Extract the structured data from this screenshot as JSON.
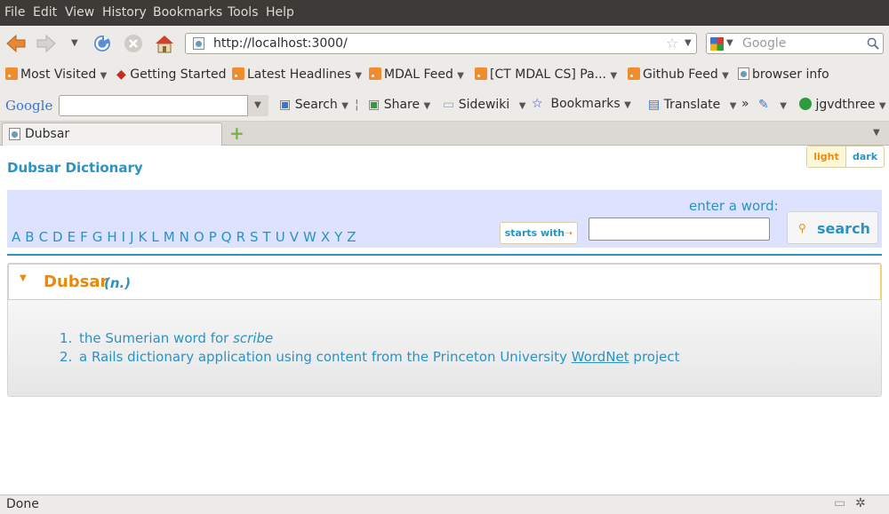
{
  "menubar": [
    "File",
    "Edit",
    "View",
    "History",
    "Bookmarks",
    "Tools",
    "Help"
  ],
  "url": "http://localhost:3000/",
  "search_engine_placeholder": "Google",
  "bookmarks": [
    "Most Visited",
    "Getting Started",
    "Latest Headlines",
    "MDAL Feed",
    "[CT MDAL CS] Pa...",
    "Github Feed",
    "browser info"
  ],
  "google_toolbar": {
    "logo": "Google",
    "search": "Search",
    "share": "Share",
    "sidewiki": "Sidewiki",
    "bookmarks": "Bookmarks",
    "translate": "Translate",
    "more": "»",
    "user": "jgvdthree"
  },
  "tab": {
    "title": "Dubsar"
  },
  "page": {
    "site_title": "Dubsar Dictionary",
    "theme_light": "light",
    "theme_dark": "dark",
    "letters": [
      "A",
      "B",
      "C",
      "D",
      "E",
      "F",
      "G",
      "H",
      "I",
      "J",
      "K",
      "L",
      "M",
      "N",
      "O",
      "P",
      "Q",
      "R",
      "S",
      "T",
      "U",
      "V",
      "W",
      "X",
      "Y",
      "Z"
    ],
    "enter_word": "enter a word:",
    "starts_with": "starts with",
    "starts_with_arrow": "➝",
    "search_label": "search",
    "entry": {
      "word": "Dubsar",
      "pos": "(n.)",
      "definitions": {
        "n1": "1.",
        "d1_text": "the Sumerian word for ",
        "d1_em": "scribe",
        "n2": "2.",
        "d2_before": "a Rails dictionary application using content from the Princeton University ",
        "d2_link": "WordNet",
        "d2_after": " project"
      }
    }
  },
  "status": "Done"
}
